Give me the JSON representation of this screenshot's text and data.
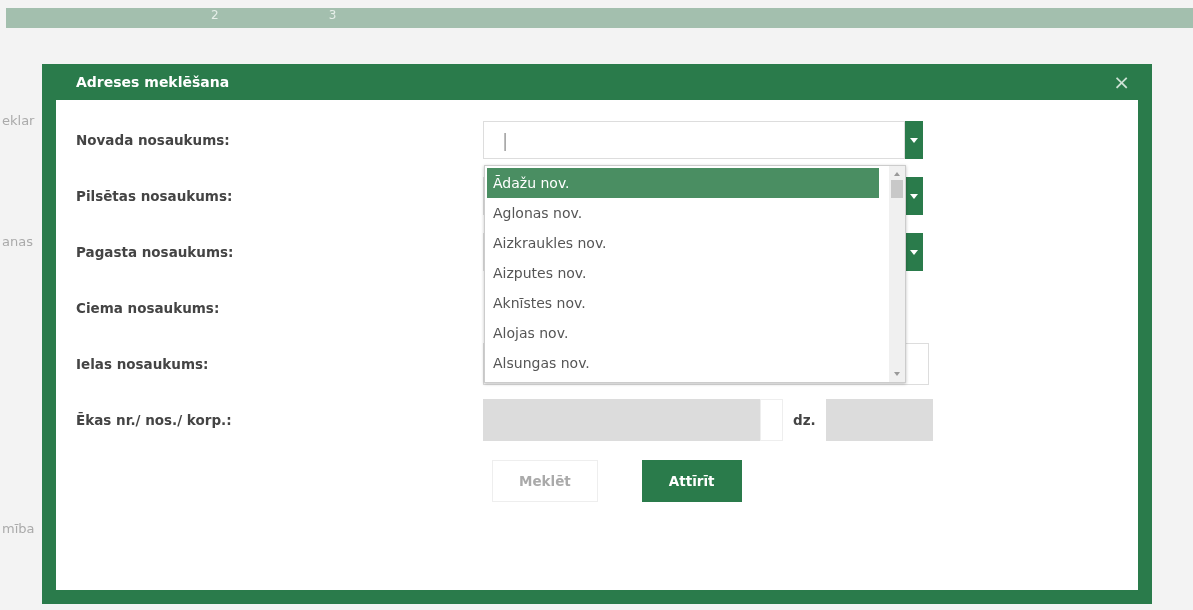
{
  "background": {
    "steps": [
      "2",
      "3"
    ],
    "fragments": [
      "eklar",
      "anas",
      "mība"
    ]
  },
  "dialog": {
    "title": "Adreses meklēšana",
    "close": "×",
    "rows": [
      {
        "label": "Novada nosaukums:",
        "kind": "combo",
        "value": "|"
      },
      {
        "label": "Pilsētas nosaukums:",
        "kind": "combo"
      },
      {
        "label": "Pagasta nosaukums:",
        "kind": "combo"
      },
      {
        "label": "Ciema nosaukums:",
        "kind": "blank"
      },
      {
        "label": "Ielas nosaukums:",
        "kind": "text"
      },
      {
        "label": "Ēkas nr./ nos./ korp.:",
        "kind": "house",
        "suffix": "dz."
      }
    ],
    "dropdown": {
      "options": [
        {
          "label": "Ādažu nov.",
          "selected": true
        },
        {
          "label": "Aglonas nov.",
          "selected": false
        },
        {
          "label": "Aizkraukles nov.",
          "selected": false
        },
        {
          "label": "Aizputes nov.",
          "selected": false
        },
        {
          "label": "Aknīstes nov.",
          "selected": false
        },
        {
          "label": "Alojas nov.",
          "selected": false
        },
        {
          "label": "Alsungas nov.",
          "selected": false
        }
      ]
    },
    "buttons": [
      {
        "label": "Meklēt",
        "disabled": true
      },
      {
        "label": "Attīrīt",
        "disabled": false
      }
    ]
  }
}
